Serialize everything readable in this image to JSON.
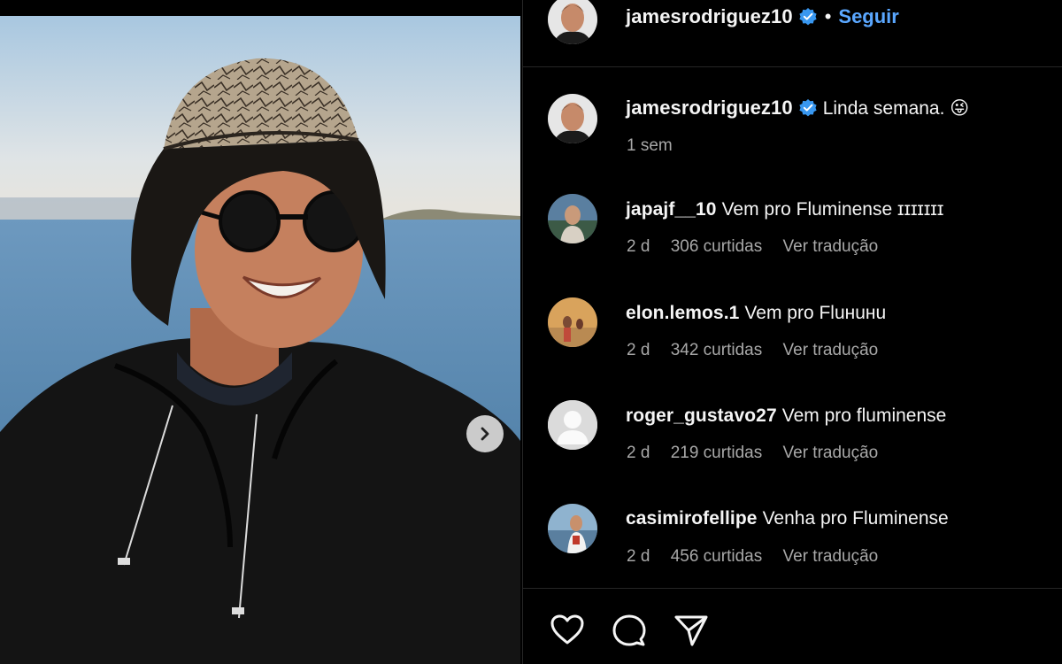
{
  "post": {
    "username": "jamesrodriguez10",
    "follow_label": "Seguir",
    "separator": "•",
    "caption": {
      "username": "jamesrodriguez10",
      "text": "Linda semana. 😜",
      "time": "1 sem"
    }
  },
  "comments": [
    {
      "username": "japajf__10",
      "text": "Vem pro Fluminense ɪɪɪɪɪɪɪ",
      "time": "2 d",
      "likes": "306 curtidas",
      "translate": "Ver tradução"
    },
    {
      "username": "elon.lemos.1",
      "text": "Vem pro Fluнuнu",
      "time": "2 d",
      "likes": "342 curtidas",
      "translate": "Ver tradução"
    },
    {
      "username": "roger_gustavo27",
      "text": "Vem pro fluminense",
      "time": "2 d",
      "likes": "219 curtidas",
      "translate": "Ver tradução"
    },
    {
      "username": "casimirofellipe",
      "text": "Venha pro Fluminense",
      "time": "2 d",
      "likes": "456 curtidas",
      "translate": "Ver tradução"
    }
  ],
  "icons": {
    "next": "chevron-right-icon",
    "verified": "verified-badge-icon",
    "like": "heart-icon",
    "comment": "comment-icon",
    "share": "send-icon"
  },
  "colors": {
    "background": "#000000",
    "text": "#f5f5f5",
    "secondary": "#a8a8a8",
    "link": "#5aa7ff",
    "verified": "#3897f0",
    "divider": "#262626"
  }
}
